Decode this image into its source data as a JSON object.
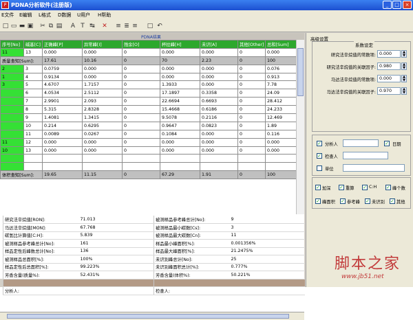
{
  "window": {
    "title": "PDNA分析软件(注册版)",
    "app_icon": "P"
  },
  "menu": [
    "E文件",
    "E编辑",
    "L格式",
    "D数据",
    "U用户",
    "H帮助"
  ],
  "toolbar_icons": [
    "new-file-icon",
    "open-folder-icon",
    "save-icon",
    "print-icon",
    "cut-icon",
    "copy-icon",
    "paste-icon",
    "font-icon",
    "text-style-icon",
    "replace-icon",
    "delete-icon",
    "align-left-icon",
    "align-center-icon",
    "align-right-icon",
    "window-icon",
    "undo-icon"
  ],
  "toolbar_glyphs": [
    "□",
    "▭",
    "▬",
    "▣",
    "✂",
    "⧉",
    "▤",
    "A",
    "T",
    "↹",
    "✕",
    "≡",
    "≣",
    "≡",
    "□",
    "↶"
  ],
  "panel_caption": "PDNA结果",
  "grid": {
    "headers": [
      "序号[No]",
      "碱基[C]",
      "正确峰[P]",
      "异常峰[I]",
      "残余[O]",
      "杯拉峰[H]",
      "未识[A]",
      "其他[Other]",
      "总和[Sum]"
    ],
    "rows": [
      [
        "11",
        "13",
        "0.000",
        "0.000",
        "0",
        "0.000",
        "0.000",
        "0",
        "0.000"
      ],
      [
        "质量查知[Sum]:",
        "",
        "17.61",
        "10.16",
        "0",
        "70",
        "2.23",
        "0",
        "100"
      ],
      [
        "2",
        "3",
        "0.0759",
        "0.000",
        "0",
        "0.000",
        "0.000",
        "0",
        "0.076"
      ],
      [
        "1",
        "4",
        "0.9134",
        "0.000",
        "0",
        "0.000",
        "0.000",
        "0",
        "0.913"
      ],
      [
        "3",
        "5",
        "4.6707",
        "1.7157",
        "0",
        "1.3933",
        "0.000",
        "0",
        "7.78"
      ],
      [
        "",
        "6",
        "4.0534",
        "2.5112",
        "0",
        "17.1897",
        "0.3358",
        "0",
        "24.09"
      ],
      [
        "",
        "7",
        "2.9901",
        "2.093",
        "0",
        "22.6694",
        "0.6693",
        "0",
        "28.412"
      ],
      [
        "",
        "8",
        "5.315",
        "2.8328",
        "0",
        "15.4668",
        "0.6186",
        "0",
        "24.233"
      ],
      [
        "",
        "9",
        "1.4081",
        "1.3415",
        "0",
        "9.5078",
        "0.2116",
        "0",
        "12.469"
      ],
      [
        "",
        "10",
        "0.214",
        "0.6295",
        "0",
        "0.9647",
        "0.0823",
        "0",
        "1.89"
      ],
      [
        "",
        "11",
        "0.0089",
        "0.0267",
        "0",
        "0.1084",
        "0.000",
        "0",
        "0.116"
      ],
      [
        "11",
        "12",
        "0.000",
        "0.000",
        "0",
        "0.000",
        "0.000",
        "0",
        "0.000"
      ],
      [
        "10",
        "13",
        "0.000",
        "0.000",
        "0",
        "0.000",
        "0.000",
        "0",
        "0.000"
      ],
      [
        "",
        "",
        "",
        "",
        "",
        "",
        "",
        "",
        ""
      ],
      [
        "",
        "",
        "",
        "",
        "",
        "",
        "",
        "",
        ""
      ],
      [
        "体积查知[Sum]:",
        "",
        "19.65",
        "11.15",
        "0",
        "67.29",
        "1.91",
        "0",
        "100"
      ]
    ]
  },
  "summary": {
    "rows": [
      [
        "研究法辛烷值[RON]:",
        "71.013",
        "被测样品参考峰总计[No]:",
        "9"
      ],
      [
        "马达法辛烷值[MON]:",
        "67.768",
        "被测样品最小碳数[Cs]:",
        "3"
      ],
      [
        "碳氢比计算值[C:H]:",
        "5.839",
        "被测样品最大碳数[Cn]:",
        "11"
      ],
      [
        "被测样品参考峰总计[No]:",
        "161",
        "样品最小峰面积[%]:",
        "0.001356%"
      ],
      [
        "样品定性后峰数总计[No]:",
        "136",
        "样品最大峰面积[%]:",
        "21.2475%"
      ],
      [
        "被测样品总面积[%]:",
        "100%",
        "未识别峰总计[No]:",
        "25"
      ],
      [
        "样品定性后总面积[%]:",
        "99.223%",
        "未识别峰面积总计[%]:",
        "0.777%"
      ],
      [
        "芳香含量(质量%):",
        "52.431%",
        "芳香含量(体积%):",
        "50.221%"
      ],
      [
        "",
        "",
        "",
        ""
      ],
      [
        "分析人:",
        "",
        "检查人:",
        ""
      ]
    ]
  },
  "right_panel": {
    "title": "高级设置",
    "coef_legend": "系数设定",
    "coefs": [
      {
        "label": "研究法辛烷值的常数项:",
        "value": "0.000"
      },
      {
        "label": "研究法辛烷值的关联因子:",
        "value": "0.980"
      },
      {
        "label": "马达法辛烷值的常数项:",
        "value": "0.000"
      },
      {
        "label": "马达法辛烷值的关联因子:",
        "value": "0.970"
      }
    ],
    "analyst_label": "分析人",
    "date_label": "日期",
    "checker_label": "检查人",
    "unit_label": "单位",
    "flags_row1": [
      "加深",
      "重算",
      "C:H",
      "峰个数"
    ],
    "flags_row2": [
      "峰面积",
      "参考峰",
      "未识别",
      "其他"
    ]
  },
  "watermark": {
    "title": "脚本之家",
    "url": "www.jb51.net"
  }
}
